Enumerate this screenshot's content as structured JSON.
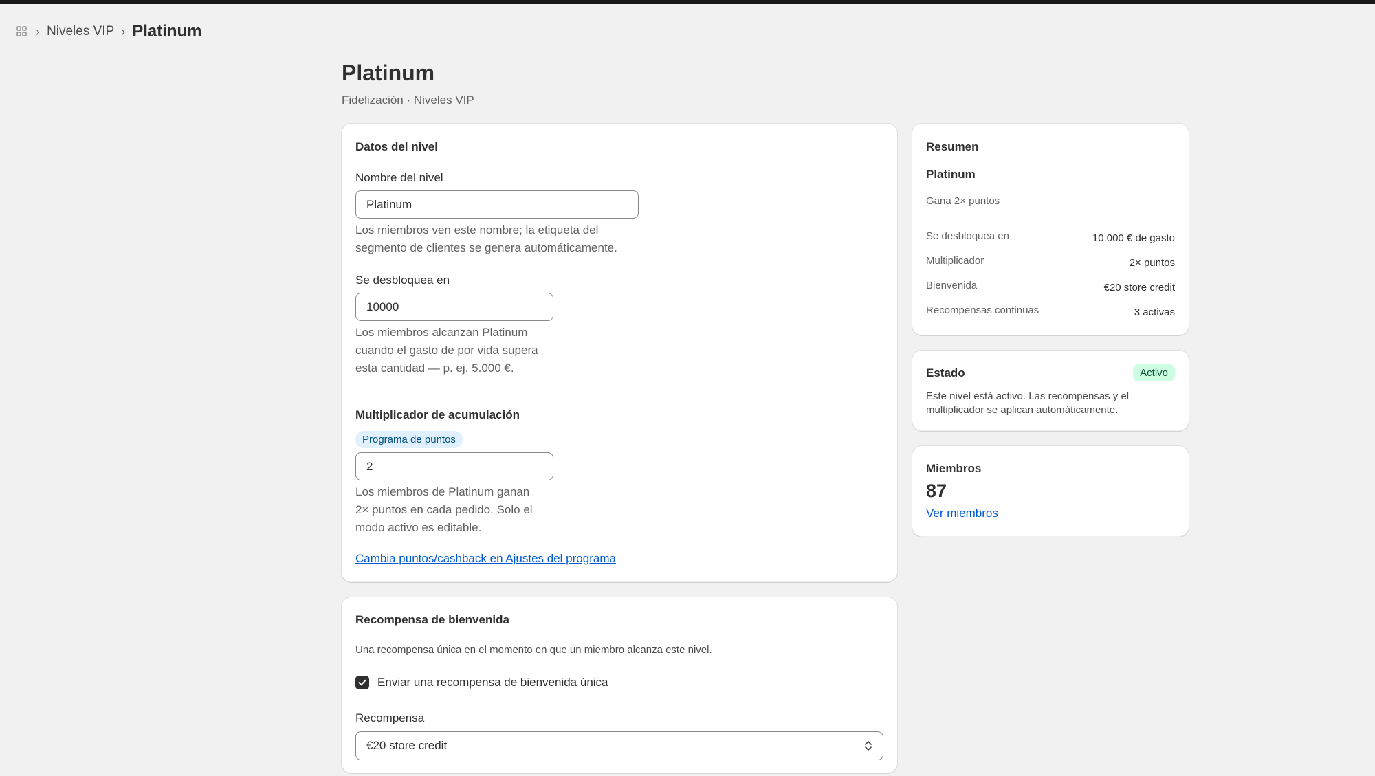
{
  "breadcrumb": {
    "icon": "apps-grid-icon",
    "parent": "Niveles VIP",
    "current": "Platinum"
  },
  "header": {
    "title": "Platinum",
    "subtitle": "Fidelización · Niveles VIP"
  },
  "tier_card": {
    "title": "Datos del nivel",
    "name_label": "Nombre del nivel",
    "name_value": "Platinum",
    "name_help_1": "Los miembros ven este nombre; la etiqueta del",
    "name_help_2": "segmento de clientes se genera automáticamente.",
    "unlock_label": "Se desbloquea en",
    "unlock_value": "10000",
    "unlock_help_1": "Los miembros alcanzan Platinum",
    "unlock_help_2": "cuando el gasto de por vida supera",
    "unlock_help_3": "esta cantidad — p. ej. 5.000 €.",
    "multiplier_label": "Multiplicador de acumulación",
    "multiplier_pill": "Programa de puntos",
    "multiplier_value": "2",
    "multiplier_help_1": "Los miembros de Platinum ganan",
    "multiplier_help_2": "2× puntos en cada pedido. Solo el",
    "multiplier_help_3": "modo activo es editable.",
    "settings_link": "Cambia puntos/cashback en Ajustes del programa"
  },
  "welcome_card": {
    "title": "Recompensa de bienvenida",
    "description": "Una recompensa única en el momento en que un miembro alcanza este nivel.",
    "checkbox_label": "Enviar una recompensa de bienvenida única",
    "checkbox_checked": true,
    "reward_label": "Recompensa",
    "reward_value": "€20 store credit"
  },
  "summary": {
    "title": "Resumen",
    "tier_name": "Platinum",
    "tagline": "Gana 2× puntos",
    "rows": [
      {
        "key": "Se desbloquea en",
        "value": "10.000 € de gasto"
      },
      {
        "key": "Multiplicador",
        "value": "2× puntos"
      },
      {
        "key": "Bienvenida",
        "value": "€20 store credit"
      },
      {
        "key": "Recompensas continuas",
        "value": "3 activas"
      }
    ]
  },
  "status": {
    "title": "Estado",
    "badge": "Activo",
    "text_1": "Este nivel está activo. Las recompensas y el",
    "text_2": "multiplicador se aplican automáticamente."
  },
  "members": {
    "title": "Miembros",
    "count": "87",
    "link": "Ver miembros"
  },
  "colors": {
    "accent_link": "#005bd3",
    "badge_bg": "#cdfee1",
    "pill_bg": "#e0f0ff",
    "page_bg": "#f1f1f1"
  }
}
